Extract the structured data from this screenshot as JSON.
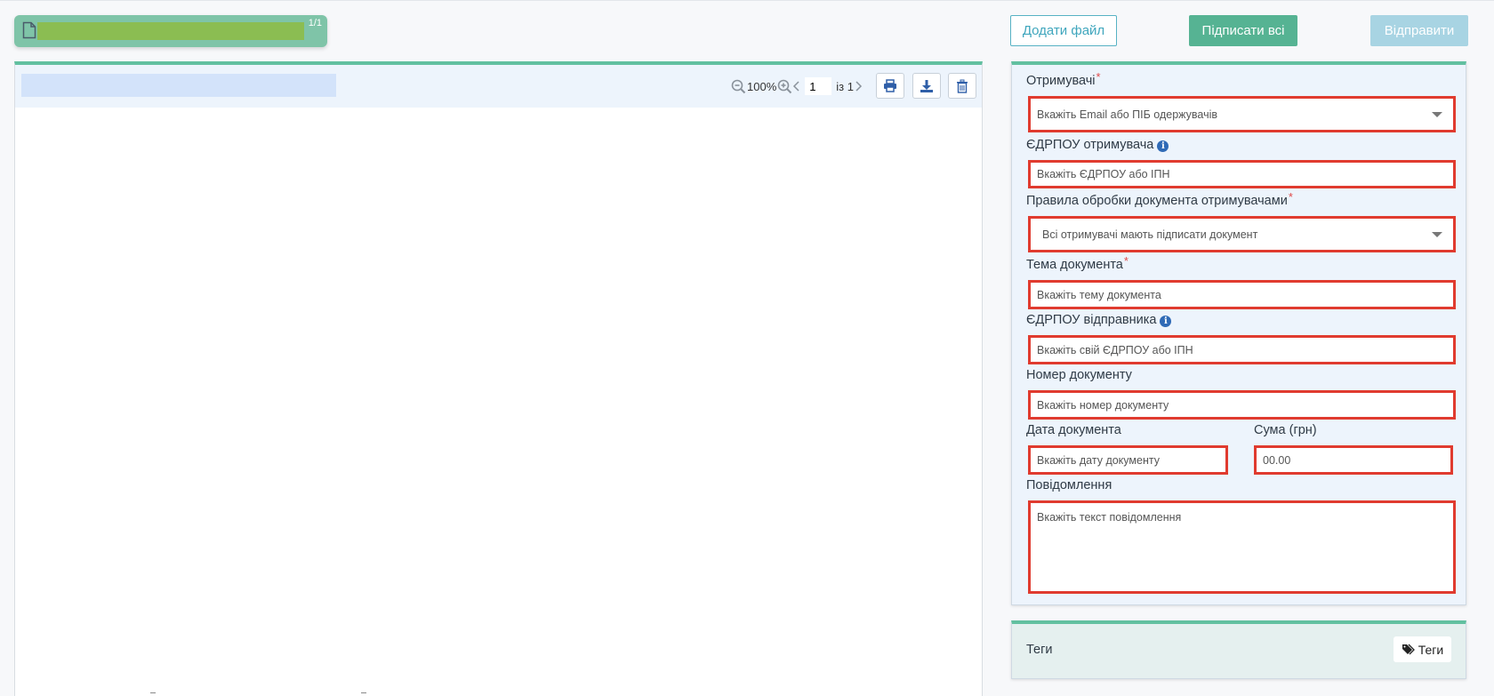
{
  "file_tab": {
    "count": "1/1"
  },
  "top_actions": {
    "add_file": "Додати файл",
    "sign_all": "Підписати всі",
    "send": "Відправити"
  },
  "viewer": {
    "zoom": "100%",
    "page_current": "1",
    "page_total": "із 1"
  },
  "form": {
    "recipients": {
      "label": "Отримувачі",
      "placeholder": "Вкажіть Email або ПІБ одержувачів"
    },
    "recipient_edrpou": {
      "label": "ЄДРПОУ отримувача",
      "placeholder": "Вкажіть ЄДРПОУ або ІПН"
    },
    "rules": {
      "label": "Правила обробки документа отримувачами",
      "value": "Всі отримувачі мають підписати документ"
    },
    "subject": {
      "label": "Тема документа",
      "placeholder": "Вкажіть тему документа"
    },
    "sender_edrpou": {
      "label": "ЄДРПОУ відправника",
      "placeholder": "Вкажіть свій ЄДРПОУ або ІПН"
    },
    "doc_number": {
      "label": "Номер документу",
      "placeholder": "Вкажіть номер документу"
    },
    "doc_date": {
      "label": "Дата документа",
      "placeholder": "Вкажіть дату документу"
    },
    "amount": {
      "label": "Сума (грн)",
      "placeholder": "00.00"
    },
    "message": {
      "label": "Повідомлення",
      "placeholder": "Вкажіть текст повідомлення"
    },
    "required_mark": "*",
    "info_mark": "i"
  },
  "tags": {
    "label": "Теги",
    "button": "Теги"
  },
  "colors": {
    "accent_green": "#62c0a0",
    "sign_button": "#56b393",
    "error_border": "#e03b2f",
    "link_blue": "#3fa6bd"
  }
}
